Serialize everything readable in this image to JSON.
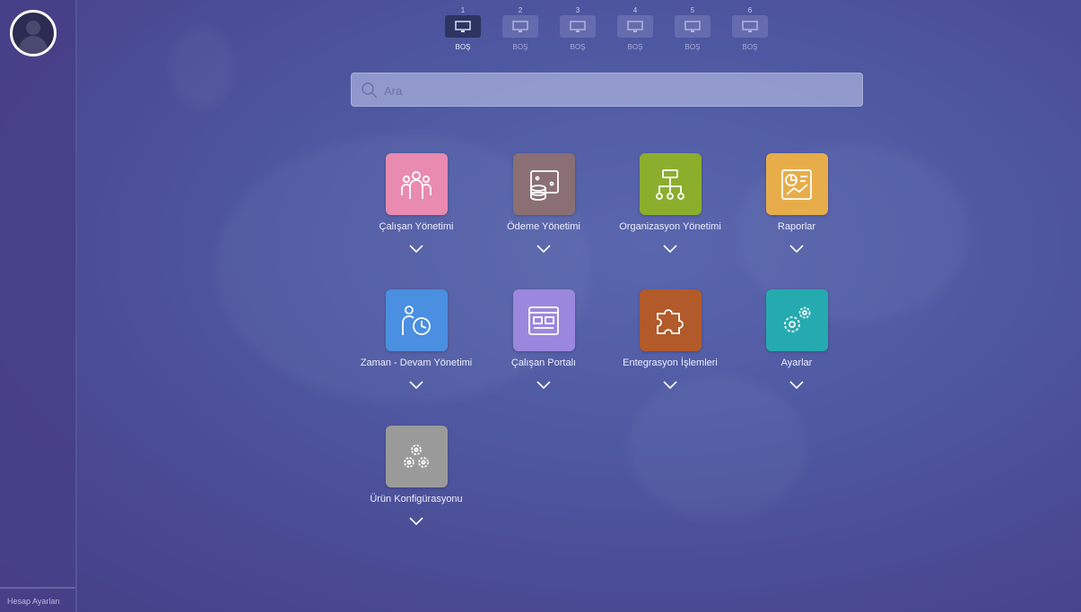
{
  "sidebar": {
    "account_label": "Hesap Ayarları"
  },
  "screens": [
    {
      "number": "1",
      "label": "BOŞ",
      "active": true
    },
    {
      "number": "2",
      "label": "BOŞ",
      "active": false
    },
    {
      "number": "3",
      "label": "BOŞ",
      "active": false
    },
    {
      "number": "4",
      "label": "BOŞ",
      "active": false
    },
    {
      "number": "5",
      "label": "BOŞ",
      "active": false
    },
    {
      "number": "6",
      "label": "BOŞ",
      "active": false
    }
  ],
  "search": {
    "placeholder": "Ara",
    "value": ""
  },
  "modules": [
    {
      "label": "Çalışan Yönetimi",
      "color": "#e98ab0",
      "icon": "people-group-icon"
    },
    {
      "label": "Ödeme Yönetimi",
      "color": "#8a7074",
      "icon": "payment-coins-icon"
    },
    {
      "label": "Organizasyon Yönetimi",
      "color": "#8cae2d",
      "icon": "org-chart-icon"
    },
    {
      "label": "Raporlar",
      "color": "#e7ad4a",
      "icon": "report-chart-icon"
    },
    {
      "label": "Zaman - Devam Yönetimi",
      "color": "#4a8fe0",
      "icon": "person-clock-icon"
    },
    {
      "label": "Çalışan Portalı",
      "color": "#9b87dd",
      "icon": "portal-window-icon"
    },
    {
      "label": "Entegrasyon İşlemleri",
      "color": "#b25a2a",
      "icon": "puzzle-icon"
    },
    {
      "label": "Ayarlar",
      "color": "#25aab0",
      "icon": "gears-icon"
    },
    {
      "label": "Ürün Konfigürasyonu",
      "color": "#9a9a9a",
      "icon": "cogs-cluster-icon"
    }
  ]
}
